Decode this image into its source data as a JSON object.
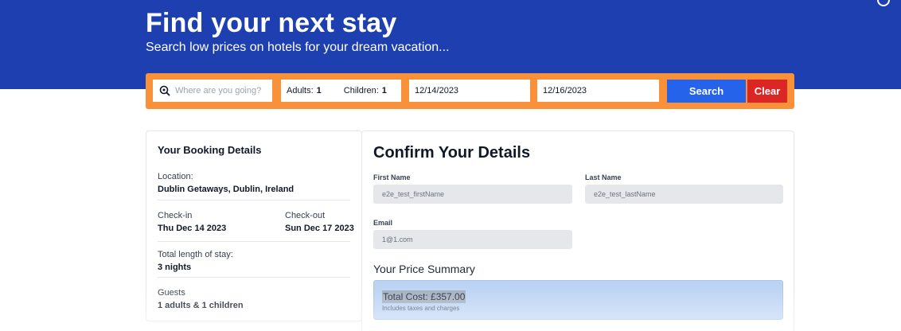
{
  "hero": {
    "title": "Find your next stay",
    "subtitle": "Search low prices on hotels for your dream vacation..."
  },
  "search": {
    "destination_placeholder": "Where are you going?",
    "search_icon": "search-icon",
    "adults_label": "Adults:",
    "adults_value": "1",
    "children_label": "Children:",
    "children_value": "1",
    "checkin": "12/14/2023",
    "checkout": "12/16/2023",
    "search_label": "Search",
    "clear_label": "Clear"
  },
  "booking": {
    "title": "Your Booking Details",
    "location_label": "Location:",
    "location_value": "Dublin Getaways, Dublin, Ireland",
    "checkin_label": "Check-in",
    "checkin_value": "Thu Dec 14 2023",
    "checkout_label": "Check-out",
    "checkout_value": "Sun Dec 17 2023",
    "length_label": "Total length of stay:",
    "length_value": "3 nights",
    "guests_label": "Guests",
    "guests_value": "1 adults & 1 children"
  },
  "confirm": {
    "title": "Confirm Your Details",
    "first_name_label": "First Name",
    "first_name_value": "e2e_test_firstName",
    "last_name_label": "Last Name",
    "last_name_value": "e2e_test_lastName",
    "email_label": "Email",
    "email_value": "1@1.com",
    "price_heading": "Your Price Summary",
    "total_cost": "Total Cost: £357.00",
    "price_note": "Includes taxes and charges"
  },
  "colors": {
    "hero_bg": "#1d3fb0",
    "search_bar_bg": "#f9913b",
    "search_button": "#2563eb",
    "clear_button": "#dc2626",
    "price_box": "#bcd3f4"
  }
}
